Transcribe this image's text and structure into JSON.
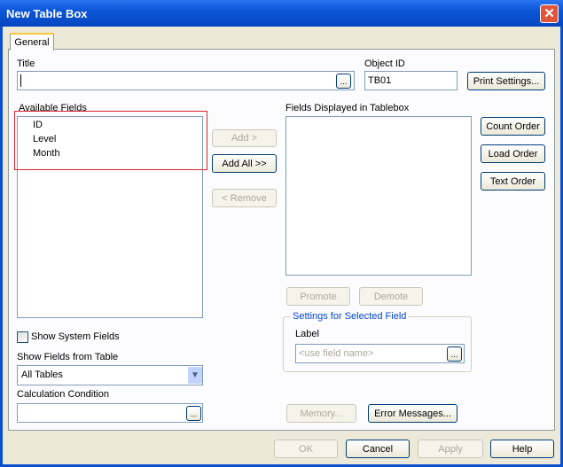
{
  "window": {
    "title": "New Table Box"
  },
  "tabs": [
    {
      "label": "General"
    }
  ],
  "title_field": {
    "label": "Title",
    "value": ""
  },
  "object_id": {
    "label": "Object ID",
    "value": "TB01"
  },
  "buttons": {
    "print_settings": "Print Settings...",
    "ellipsis": "...",
    "add": "Add >",
    "add_all": "Add All >>",
    "remove": "< Remove",
    "count_order": "Count Order",
    "load_order": "Load Order",
    "text_order": "Text Order",
    "promote": "Promote",
    "demote": "Demote",
    "memory": "Memory...",
    "error_messages": "Error Messages...",
    "ok": "OK",
    "cancel": "Cancel",
    "apply": "Apply",
    "help": "Help"
  },
  "available_fields": {
    "label": "Available Fields",
    "items": [
      "ID",
      "Level",
      "Month"
    ]
  },
  "displayed_fields": {
    "label": "Fields Displayed in Tablebox"
  },
  "settings_group": {
    "legend": "Settings for Selected Field",
    "label_caption": "Label",
    "label_placeholder": "<use field name>"
  },
  "show_system_fields": {
    "label": "Show System Fields",
    "checked": false
  },
  "show_fields_from_table": {
    "label": "Show Fields from Table",
    "value": "All Tables"
  },
  "calculation_condition": {
    "label": "Calculation Condition",
    "value": ""
  },
  "colors": {
    "highlight_box": "#d9262b",
    "group_legend": "#0046d5"
  }
}
